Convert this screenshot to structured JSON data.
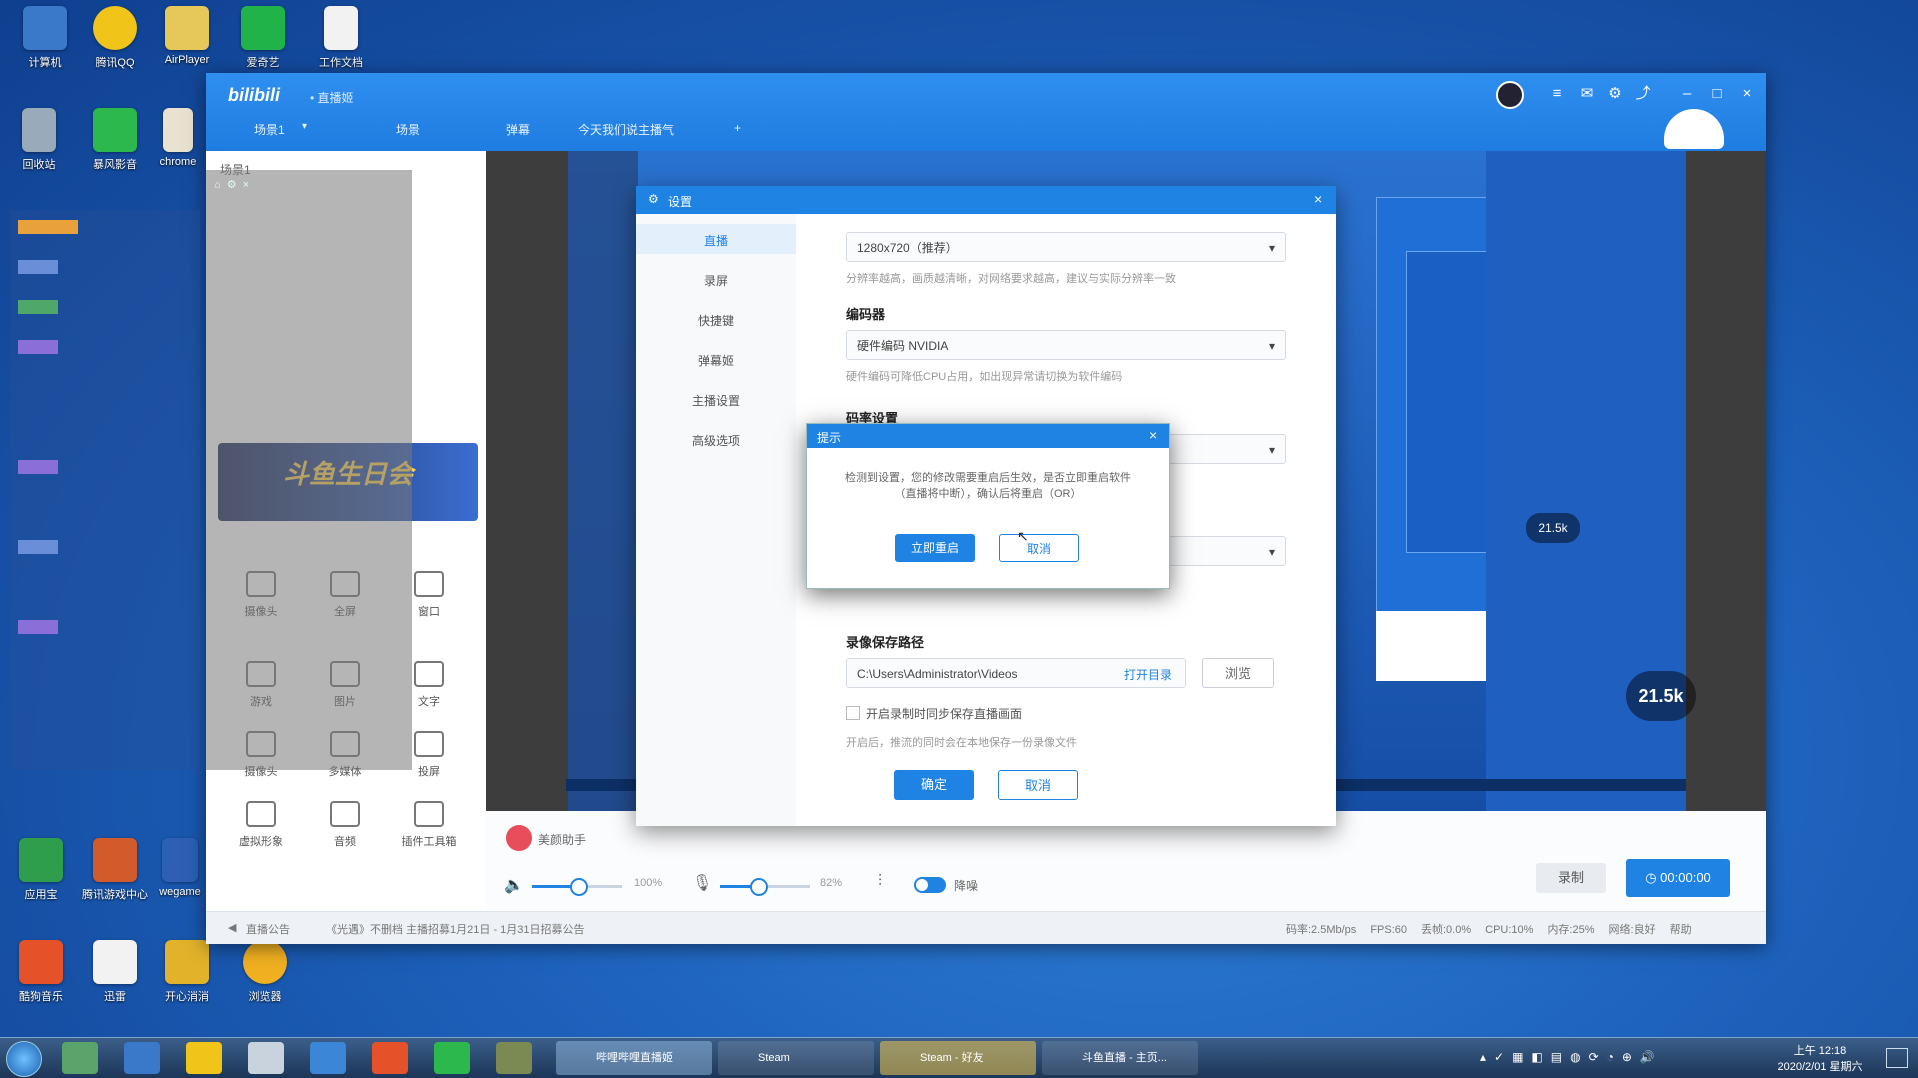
{
  "desktop": {
    "icons_top": [
      {
        "label": "计算机",
        "color": "#3a78c9",
        "icon": "computer-icon"
      },
      {
        "label": "腾讯QQ",
        "color": "#f0c419",
        "icon": "qq-penguin-icon"
      },
      {
        "label": "AirPlayer",
        "color": "#e6c85a",
        "icon": "folder-icon"
      },
      {
        "label": "爱奇艺",
        "color": "#20b34a",
        "icon": "iqiyi-icon"
      },
      {
        "label": "工作文档",
        "color": "#f2f2f2",
        "icon": "document-icon"
      }
    ],
    "icons_left": [
      {
        "label": "回收站",
        "color": "#9ab",
        "icon": "recycle-bin-icon"
      },
      {
        "label": "暴风影音",
        "color": "#2db84d",
        "icon": "play-icon"
      },
      {
        "label": "chrome",
        "color": "#e9e2d0",
        "icon": "chrome-icon"
      }
    ],
    "icons_bottom": [
      {
        "label": "应用宝",
        "color": "#2e9e4c",
        "icon": "app-store-icon"
      },
      {
        "label": "腾讯游戏中心",
        "color": "#d35a2b",
        "icon": "game-center-icon"
      },
      {
        "label": "wegame",
        "color": "#2d5fb5",
        "icon": "wegame-icon"
      },
      {
        "label": "酷狗音乐",
        "color": "#e5522a",
        "icon": "kugou-icon"
      },
      {
        "label": "迅雷",
        "color": "#f2f2f2",
        "icon": "player-icon"
      },
      {
        "label": "开心消消",
        "color": "#e2b22a",
        "icon": "game-icon"
      },
      {
        "label": "浏览器",
        "color": "#f0b021",
        "icon": "browser-icon"
      }
    ]
  },
  "taskbar": {
    "buttons": [
      {
        "label": "哔哩哔哩直播姬",
        "active": true
      },
      {
        "label": "Steam",
        "active": false
      },
      {
        "label": "Steam - 好友",
        "active": true
      },
      {
        "label": "斗鱼直播 - 主页...",
        "active": false
      }
    ],
    "clock_time": "上午 12:18",
    "clock_date": "2020/2/01 星期六"
  },
  "app": {
    "logo": "bilibili",
    "subtitle": "• 直播姬",
    "tabs": [
      "场景1",
      "场景",
      "弹幕",
      "今天我们说主播气",
      "+"
    ],
    "left_panel": {
      "title": "场景1",
      "sources": [
        {
          "label": "摄像头",
          "icon": "camera-icon"
        },
        {
          "label": "全屏",
          "icon": "monitor-icon"
        },
        {
          "label": "窗口",
          "icon": "window-icon"
        },
        {
          "label": "游戏",
          "icon": "gamepad-icon"
        },
        {
          "label": "图片",
          "icon": "image-icon"
        },
        {
          "label": "文字",
          "icon": "text-icon"
        },
        {
          "label": "摄像头",
          "icon": "webcam-icon"
        },
        {
          "label": "多媒体",
          "icon": "media-icon"
        },
        {
          "label": "投屏",
          "icon": "phone-icon"
        },
        {
          "label": "虚拟形象",
          "icon": "avatar-icon"
        },
        {
          "label": "音频",
          "icon": "music-icon"
        },
        {
          "label": "插件工具箱",
          "icon": "plugin-icon"
        }
      ],
      "banner": "斗鱼生日会"
    },
    "bottom": {
      "speaker_volume": "100%",
      "speaker_level": 1.0,
      "mic_volume": "82%",
      "mic_level": 0.82,
      "denoise_label": "降噪",
      "record_label": "录制",
      "live_label": "00:00:00",
      "beauty_label": "美颜助手"
    },
    "statusbar": {
      "notice": "直播公告",
      "notice_text": "《光遇》不删档 主播招募1月21日 - 1月31日招募公告",
      "stats": [
        "码率:2.5Mb/ps",
        "FPS:60",
        "丢帧:0.0%",
        "CPU:10%",
        "内存:25%",
        "网络:良好",
        "帮助"
      ]
    }
  },
  "settings": {
    "title": "设置",
    "nav": [
      "直播",
      "录屏",
      "快捷键",
      "弹幕姬",
      "主播设置",
      "高级选项"
    ],
    "resolution_value": "1280x720（推荐）",
    "resolution_hint": "分辨率越高，画质越清晰，对网络要求越高，建议与实际分辨率一致",
    "encoder_label": "编码器",
    "encoder_value": "硬件编码 NVIDIA",
    "encoder_hint": "硬件编码可降低CPU占用，如出现异常请切换为软件编码",
    "bitrate_label": "码率设置",
    "record_path_label": "录像保存路径",
    "record_path_value": "C:\\Users\\Administrator\\Videos",
    "open_folder": "打开目录",
    "browse": "浏览",
    "checkbox_label": "开启录制时同步保存直播画面",
    "checkbox_hint": "开启后，推流的同时会在本地保存一份录像文件",
    "ok": "确定",
    "cancel": "取消"
  },
  "prompt": {
    "title": "提示",
    "message": "检测到设置，您的修改需要重启后生效，是否立即重启软件（直播将中断），确认后将重启（OR）",
    "confirm": "立即重启",
    "cancel": "取消"
  },
  "overlay": {
    "likes_left": "21.5k",
    "likes_right": "21.5k"
  }
}
